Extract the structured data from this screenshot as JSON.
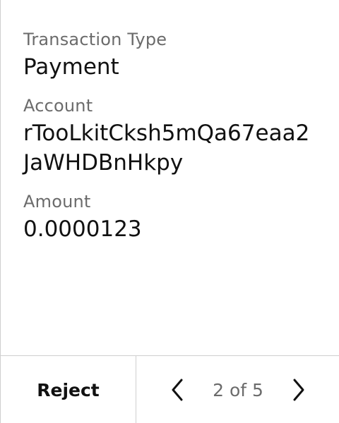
{
  "fields": [
    {
      "label": "Transaction Type",
      "value": "Payment"
    },
    {
      "label": "Account",
      "value": "rTooLkitCksh5mQa67eaa2JaWHDBnHkpy"
    },
    {
      "label": "Amount",
      "value": "0.0000123"
    }
  ],
  "footer": {
    "reject_label": "Reject",
    "pagination": {
      "text": "2 of 5",
      "current": 2,
      "total": 5
    },
    "icons": {
      "previous": "chevron-left-icon",
      "next": "chevron-right-icon"
    }
  },
  "colors": {
    "label": "#6b6b6b",
    "value": "#111111",
    "border": "#cfcfcf",
    "background": "#ffffff"
  }
}
